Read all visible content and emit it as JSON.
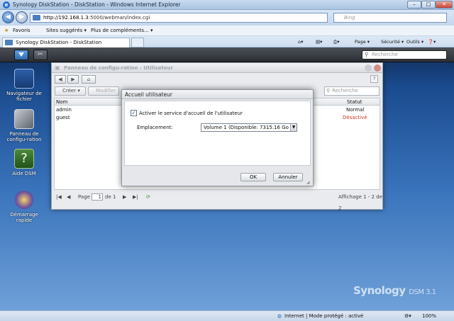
{
  "window": {
    "title": "Synology DiskStation - DiskStation - Windows Internet Explorer",
    "address_host": "http://192.168.1.3",
    "address_path": ":5000/webman/index.cgi",
    "search_placeholder": "Bing"
  },
  "favbar": {
    "favoris": "Favoris",
    "sites": "Sites suggérés ▾",
    "plus": "Plus de compléments... ▾"
  },
  "tab": {
    "title": "Synology DiskStation - DiskStation"
  },
  "commandbar": {
    "page": "Page ▾",
    "securite": "Sécurité ▾",
    "outils": "Outils ▾",
    "help": "❓▾"
  },
  "dsm": {
    "search_placeholder": "Recherche",
    "desktop_icons": [
      {
        "label": "Navigateur de fichier"
      },
      {
        "label": "Panneau de configu-ration"
      },
      {
        "label": "Aide DSM"
      },
      {
        "label": "Démarrage rapide"
      }
    ],
    "logo_brand": "Synology",
    "logo_product": "DSM 3.1"
  },
  "control_panel": {
    "title": "Panneau de configu-ration - Utilisateur",
    "create": "Créer",
    "modify": "Modifier",
    "search_placeholder": "Recherche",
    "columns": {
      "name": "Nom",
      "status": "Statut"
    },
    "rows": [
      {
        "name": "admin",
        "status": "Normal"
      },
      {
        "name": "guest",
        "status": "Désactivé"
      }
    ],
    "pager": {
      "page_label": "Page",
      "page_value": "1",
      "of": "de 1",
      "display": "Affichage 1 - 2 de 2"
    }
  },
  "modal": {
    "title": "Accueil utilisateur",
    "checkbox_label": "Activer le service d'accueil de l'utilisateur",
    "location_label": "Emplacement:",
    "location_value": "Volume 1 (Disponible: 7315.16 Go )",
    "ok": "OK",
    "cancel": "Annuler"
  },
  "statusbar": {
    "zone": "Internet | Mode protégé : activé",
    "zoom": "100%"
  },
  "colors": {
    "disabled_status": "#d9342b",
    "desktop_top": "#0f2a55",
    "desktop_bottom": "#6fa0d8"
  }
}
